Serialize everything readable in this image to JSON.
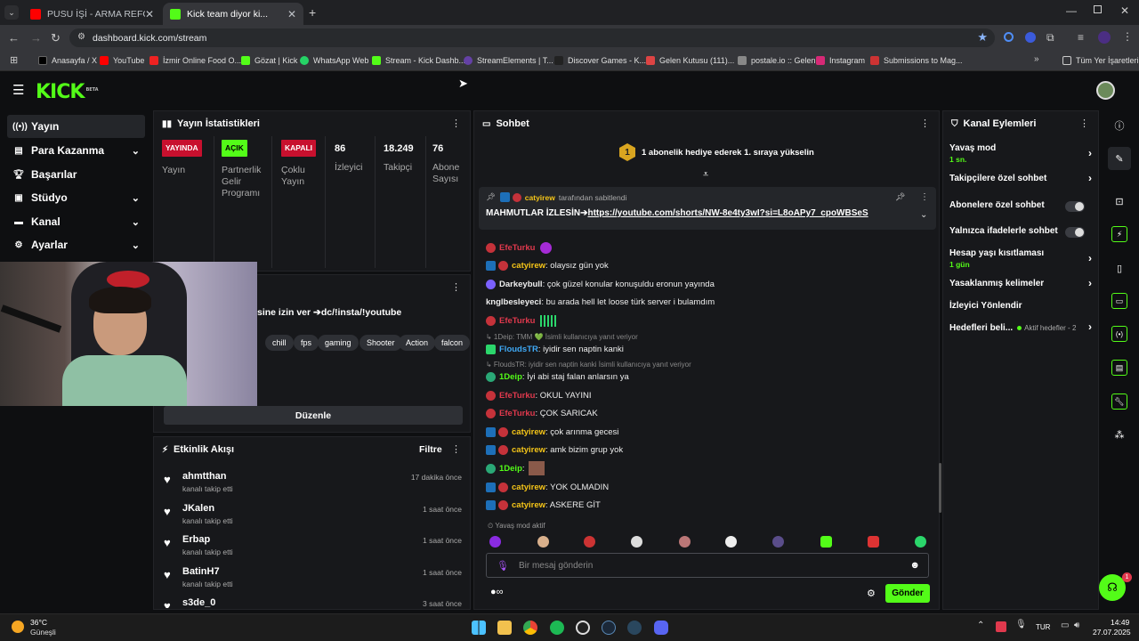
{
  "browser": {
    "tabs": [
      {
        "label": "PUSU İŞİ - ARMA REFORGER - Y",
        "active": false
      },
      {
        "label": "Kick team diyor ki...",
        "active": true
      }
    ],
    "url": "dashboard.kick.com/stream",
    "bookmarks": [
      "Anasayfa / X",
      "YouTube",
      "İzmir Online Food O...",
      "Gözat | Kick",
      "WhatsApp Web",
      "Stream - Kick Dashb...",
      "StreamElements | T...",
      "Discover Games - K...",
      "Gelen Kutusu (111)...",
      "postale.io :: Gelen",
      "Instagram",
      "Submissions to Mag...",
      "Tüm Yer İşaretleri"
    ]
  },
  "app": {
    "logo": "KICK",
    "logo_tag": "BETA"
  },
  "sidebar": {
    "items": [
      {
        "label": "Yayın",
        "icon": "broadcast-icon",
        "active": true
      },
      {
        "label": "Para Kazanma",
        "icon": "money-icon",
        "expandable": true
      },
      {
        "label": "Başarılar",
        "icon": "trophy-icon"
      },
      {
        "label": "Stüdyo",
        "icon": "studio-icon",
        "expandable": true
      },
      {
        "label": "Kanal",
        "icon": "channel-icon",
        "expandable": true
      },
      {
        "label": "Ayarlar",
        "icon": "gear-icon",
        "expandable": true
      }
    ]
  },
  "stats_panel": {
    "title": "Yayın İstatistikleri",
    "items": [
      {
        "badge": "YAYINDA",
        "label": "Yayın",
        "color": "#c8102e"
      },
      {
        "badge": "AÇIK",
        "label": "Partnerlik Gelir Programı",
        "color": "#53fc18"
      },
      {
        "badge": "KAPALI",
        "label": "Çoklu Yayın",
        "color": "#c8102e"
      },
      {
        "value": "86",
        "label": "İzleyici"
      },
      {
        "value": "18.249",
        "label": "Takipçi"
      },
      {
        "value": "76",
        "label": "Abone Sayısı"
      }
    ]
  },
  "stream_info": {
    "title_fragment": "sine izin ver ➔dc/!insta/!youtube",
    "tags": [
      "chill",
      "fps",
      "gaming",
      "Shooter",
      "Action",
      "falcon"
    ],
    "edit_label": "Düzenle"
  },
  "events": {
    "title": "Etkinlik Akışı",
    "filter_label": "Filtre",
    "items": [
      {
        "name": "ahmtthan",
        "action": "kanalı takip etti",
        "time": "17 dakika önce"
      },
      {
        "name": "JKalen",
        "action": "kanalı takip etti",
        "time": "1 saat önce"
      },
      {
        "name": "Erbap",
        "action": "kanalı takip etti",
        "time": "1 saat önce"
      },
      {
        "name": "BatinH7",
        "action": "kanalı takip etti",
        "time": "1 saat önce"
      },
      {
        "name": "s3de_0",
        "action": "",
        "time": "3 saat önce"
      }
    ]
  },
  "chat": {
    "title": "Sohbet",
    "sub_goal_number": "1",
    "sub_goal": "1 abonelik hediye ederek 1. sıraya yükselin",
    "pinned_by_user": "catyirew",
    "pinned_by_suffix": "tarafından sabitlendi",
    "pinned_prefix": "MAHMUTLAR İZLESİN➔",
    "pinned_link": "https://youtube.com/shorts/NW-8e4ty3wI?si=L8oAPy7_cpoWBSeS",
    "messages": [
      {
        "user": "EfeTurku",
        "text": "",
        "color": "#e0394d"
      },
      {
        "user": "catyirew",
        "text": ": olaysız gün yok",
        "color": "#f5c518"
      },
      {
        "user": "Darkeybull",
        "text": ": çok güzel konular konuşuldu eronun yayında",
        "color": "#ffffff"
      },
      {
        "user": "knglbesleyeci",
        "text": ": bu arada hell let loose türk server i bulamdım",
        "color": "#ffffff"
      },
      {
        "user": "EfeTurku",
        "text": "",
        "color": "#e0394d"
      },
      {
        "reply": "↳ 1Deip: TMM 💚 İsimli kullanıcıya yanıt veriyor",
        "user": "FloudsTR",
        "text": ": iyidir sen naptin kanki",
        "color": "#3fa9f5"
      },
      {
        "reply": "↳ FloudsTR: iyidir sen naptin kanki İsimli kullanıcıya yanıt veriyor",
        "user": "1Deip",
        "text": ": İyi abi staj falan anlarsın ya",
        "color": "#53fc18"
      },
      {
        "user": "EfeTurku",
        "text": ": OKUL YAYINI",
        "color": "#e0394d"
      },
      {
        "user": "EfeTurku",
        "text": ": ÇOK SARICAK",
        "color": "#e0394d"
      },
      {
        "user": "catyirew",
        "text": ": çok arınma gecesi",
        "color": "#f5c518"
      },
      {
        "user": "catyirew",
        "text": ": amk bizim grup yok",
        "color": "#f5c518"
      },
      {
        "user": "1Deip",
        "text": ":",
        "color": "#53fc18"
      },
      {
        "user": "catyirew",
        "text": ": YOK OLMADIN",
        "color": "#f5c518"
      },
      {
        "user": "catyirew",
        "text": ": ASKERE GİT",
        "color": "#f5c518"
      }
    ],
    "slow_mode_note": "Yavaş mod aktif",
    "input_placeholder": "Bir mesaj gönderin",
    "send_label": "Gönder"
  },
  "channel_actions": {
    "title": "Kanal Eylemleri",
    "items": [
      {
        "label": "Yavaş mod",
        "value": "1 sn.",
        "kind": "chevron"
      },
      {
        "label": "Takipçilere özel sohbet",
        "kind": "chevron"
      },
      {
        "label": "Abonelere özel sohbet",
        "kind": "toggle"
      },
      {
        "label": "Yalnızca ifadelerle sohbet",
        "kind": "toggle"
      },
      {
        "label": "Hesap yaşı kısıtlaması",
        "value": "1 gün",
        "kind": "chevron"
      },
      {
        "label": "Yasaklanmış kelimeler",
        "kind": "chevron"
      },
      {
        "label": "İzleyici Yönlendir",
        "kind": "none"
      },
      {
        "label": "Hedefleri beli...",
        "extra": "Aktif hedefler - 2",
        "kind": "chevron"
      }
    ]
  },
  "taskbar": {
    "weather_temp": "36°C",
    "weather_desc": "Güneşli",
    "lang": "TUR",
    "time": "14:49",
    "date": "27.07.2025"
  },
  "support_badge": "1",
  "colors": {
    "accent": "#53fc18",
    "live": "#c8102e"
  }
}
